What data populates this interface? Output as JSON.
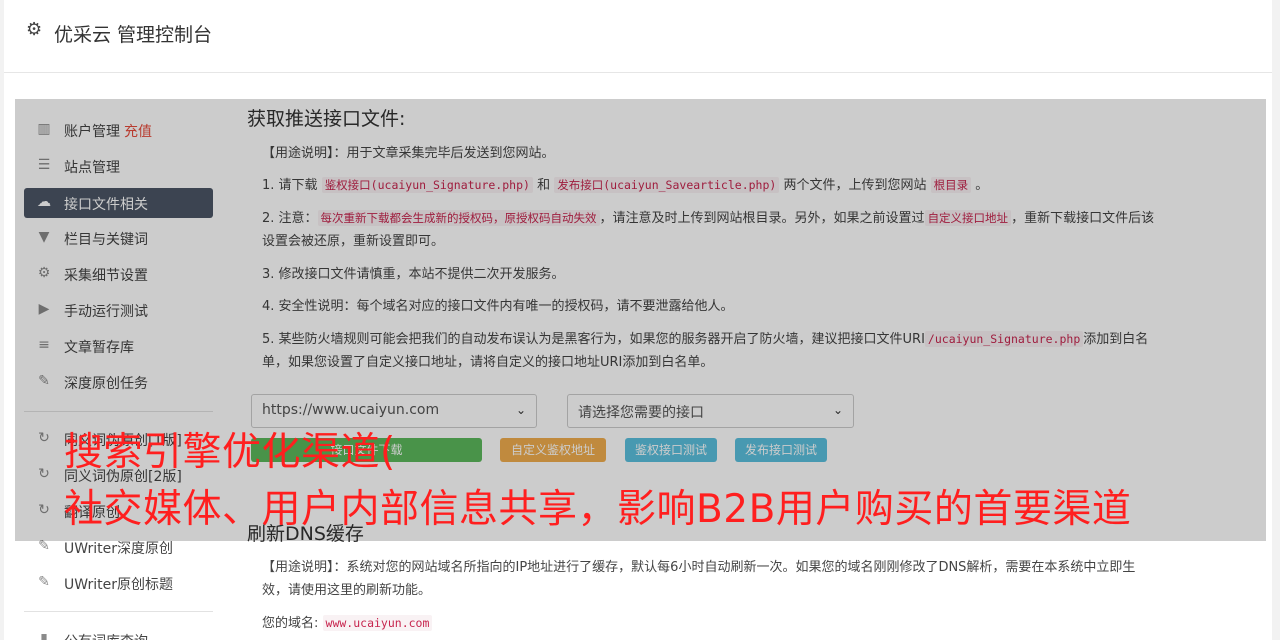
{
  "header": {
    "title": "优采云 管理控制台",
    "icon": "gear-icon"
  },
  "sidebar": {
    "items": [
      {
        "label": "账户管理",
        "extra": "充值",
        "icon": "bar-chart-icon"
      },
      {
        "label": "站点管理",
        "icon": "list-icon"
      },
      {
        "label": "接口文件相关",
        "icon": "cloud-download-icon",
        "active": true
      },
      {
        "label": "栏目与关键词",
        "icon": "filter-icon"
      },
      {
        "label": "采集细节设置",
        "icon": "gears-icon"
      },
      {
        "label": "手动运行测试",
        "icon": "play-circle-icon"
      },
      {
        "label": "文章暂存库",
        "icon": "database-icon"
      },
      {
        "label": "深度原创任务",
        "icon": "edit-icon"
      },
      {
        "label": "同义词伪原创[1版]",
        "icon": "refresh-icon"
      },
      {
        "label": "同义词伪原创[2版]",
        "icon": "refresh-icon"
      },
      {
        "label": "翻译原创",
        "icon": "refresh-icon"
      },
      {
        "label": "UWriter深度原创",
        "icon": "edit-icon"
      },
      {
        "label": "UWriter原创标题",
        "icon": "edit-icon"
      },
      {
        "label": "公有词库查询",
        "icon": "book-icon"
      }
    ]
  },
  "section1": {
    "title": "获取推送接口文件:",
    "usage": "【用途说明】：用于文章采集完毕后发送到您网站。",
    "s1_a": "1. 请下载",
    "s1_code1": "鉴权接口(ucaiyun_Signature.php)",
    "s1_and": "和",
    "s1_code2": "发布接口(ucaiyun_Savearticle.php)",
    "s1_b": "两个文件，上传到您网站",
    "s1_code3": "根目录",
    "s1_c": "。",
    "s2_a": "2. 注意：",
    "s2_code1": "每次重新下载都会生成新的授权码，原授权码自动失效",
    "s2_b": "，请注意及时上传到网站根目录。另外，如果之前设置过",
    "s2_code2": "自定义接口地址",
    "s2_c": "，重新下载接口文件后该设置会被还原，重新设置即可。",
    "s3": "3. 修改接口文件请慎重，本站不提供二次开发服务。",
    "s4": "4. 安全性说明：每个域名对应的接口文件内有唯一的授权码，请不要泄露给他人。",
    "s5_a": "5. 某些防火墙规则可能会把我们的自动发布误认为是黑客行为，如果您的服务器开启了防火墙，建议把接口文件URI",
    "s5_code": "/ucaiyun_Signature.php",
    "s5_b": "添加到白名单，如果您设置了自定义接口地址，请将自定义的接口地址URI添加到白名单。",
    "site_select": "https://www.ucaiyun.com",
    "api_select": "请选择您需要的接口",
    "btn_download": "接口文件下载",
    "btn_custom": "自定义鉴权地址",
    "btn_test_auth": "鉴权接口测试",
    "btn_test_publish": "发布接口测试"
  },
  "section2": {
    "title": "刷新DNS缓存",
    "usage": "【用途说明】：系统对您的网站域名所指向的IP地址进行了缓存，默认每6小时自动刷新一次。如果您的域名刚刚修改了DNS解析，需要在本系统中立即生效，请使用这里的刷新功能。",
    "domain_label": "您的域名:",
    "domain_value": "www.ucaiyun.com"
  },
  "overlay": {
    "line1": "搜索引擎优化渠道(",
    "line2": "社交媒体、用户内部信息共享，影响B2B用户购买的首要渠道"
  },
  "colors": {
    "active_nav": "#4c5666",
    "btn_green": "#5cb85c",
    "btn_orange": "#f0ad4e",
    "btn_blue": "#5bc0de",
    "overlay_text": "#ff1f1f"
  }
}
